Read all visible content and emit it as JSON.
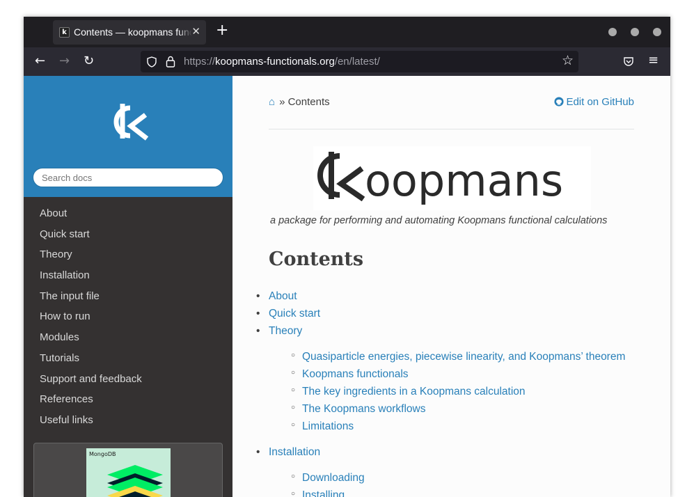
{
  "browser": {
    "tab_title": "Contents — koopmans functionals",
    "url_scheme": "https://",
    "url_host": "koopmans-functionals.org",
    "url_path": "/en/latest/"
  },
  "sidebar": {
    "search_placeholder": "Search docs",
    "items": [
      "About",
      "Quick start",
      "Theory",
      "Installation",
      "The input file",
      "How to run",
      "Modules",
      "Tutorials",
      "Support and feedback",
      "References",
      "Useful links"
    ],
    "ad_label": "MongoDB"
  },
  "content": {
    "breadcrumb_separator": "»",
    "breadcrumb_current": "Contents",
    "edit_link": "Edit on GitHub",
    "banner_text": "koopmans",
    "tagline": "a package for performing and automating Koopmans functional calculations",
    "heading": "Contents",
    "toc": {
      "about": "About",
      "quick_start": "Quick start",
      "theory": "Theory",
      "theory_sub": [
        "Quasiparticle energies, piecewise linearity, and Koopmans’ theorem",
        "Koopmans functionals",
        "The key ingredients in a Koopmans calculation",
        "The Koopmans workflows",
        "Limitations"
      ],
      "installation": "Installation",
      "installation_sub": [
        "Downloading",
        "Installing"
      ]
    }
  },
  "colors": {
    "accent": "#2980b9",
    "sidebar_bg": "#343131",
    "link": "#2980b9"
  }
}
